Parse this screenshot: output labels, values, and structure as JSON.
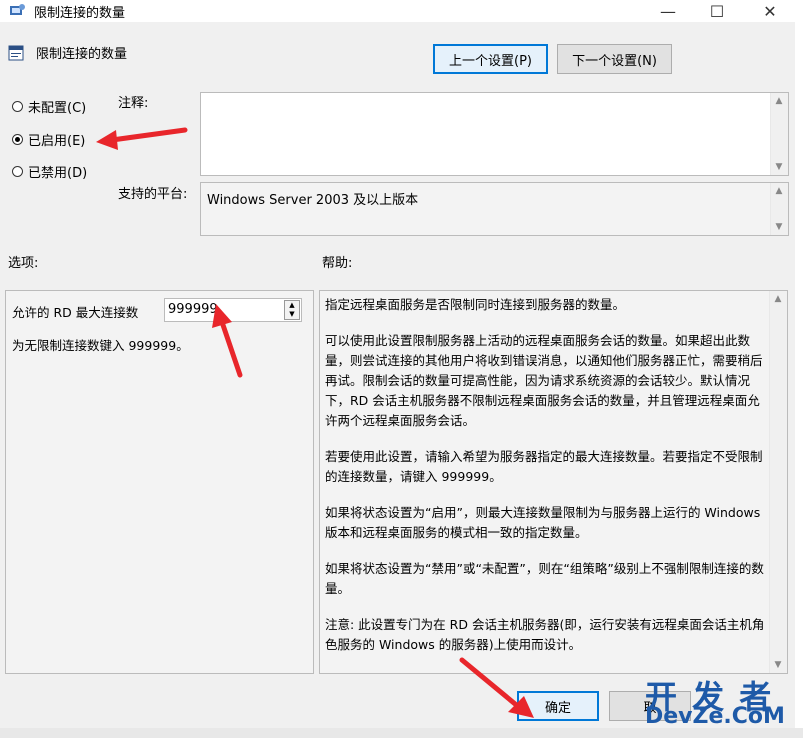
{
  "window": {
    "title": "限制连接的数量",
    "controls": {
      "minimize": "—",
      "maximize": "☐",
      "close": "✕"
    }
  },
  "header": {
    "policy_name": "限制连接的数量"
  },
  "nav": {
    "prev_label": "上一个设置(P)",
    "next_label": "下一个设置(N)"
  },
  "state": {
    "options": [
      {
        "label": "未配置(C)",
        "selected": false
      },
      {
        "label": "已启用(E)",
        "selected": true
      },
      {
        "label": "已禁用(D)",
        "selected": false
      }
    ]
  },
  "comment": {
    "label": "注释:",
    "value": ""
  },
  "platform": {
    "label": "支持的平台:",
    "value": "Windows Server 2003 及以上版本"
  },
  "options_panel": {
    "heading": "选项:",
    "max_connections_label": "允许的 RD 最大连接数",
    "max_connections_value": "999999",
    "hint": "为无限制连接数键入 999999。"
  },
  "help_panel": {
    "heading": "帮助:",
    "paragraphs": [
      "指定远程桌面服务是否限制同时连接到服务器的数量。",
      "可以使用此设置限制服务器上活动的远程桌面服务会话的数量。如果超出此数量，则尝试连接的其他用户将收到错误消息，以通知他们服务器正忙，需要稍后再试。限制会话的数量可提高性能，因为请求系统资源的会话较少。默认情况下，RD 会话主机服务器不限制远程桌面服务会话的数量，并且管理远程桌面允许两个远程桌面服务会话。",
      "若要使用此设置，请输入希望为服务器指定的最大连接数量。若要指定不受限制的连接数量，请键入 999999。",
      "如果将状态设置为“启用”，则最大连接数量限制为与服务器上运行的 Windows 版本和远程桌面服务的模式相一致的指定数量。",
      "如果将状态设置为“禁用”或“未配置”，则在“组策略”级别上不强制限制连接的数量。",
      "注意: 此设置专门为在 RD 会话主机服务器(即，运行安装有远程桌面会话主机角色服务的 Windows 的服务器)上使用而设计。"
    ]
  },
  "footer": {
    "ok_label": "确定",
    "cancel_label": "取"
  },
  "watermark": {
    "line1": "开 发 者",
    "line2": "DevZe.CoM"
  },
  "annotation_color": "#e8262b"
}
